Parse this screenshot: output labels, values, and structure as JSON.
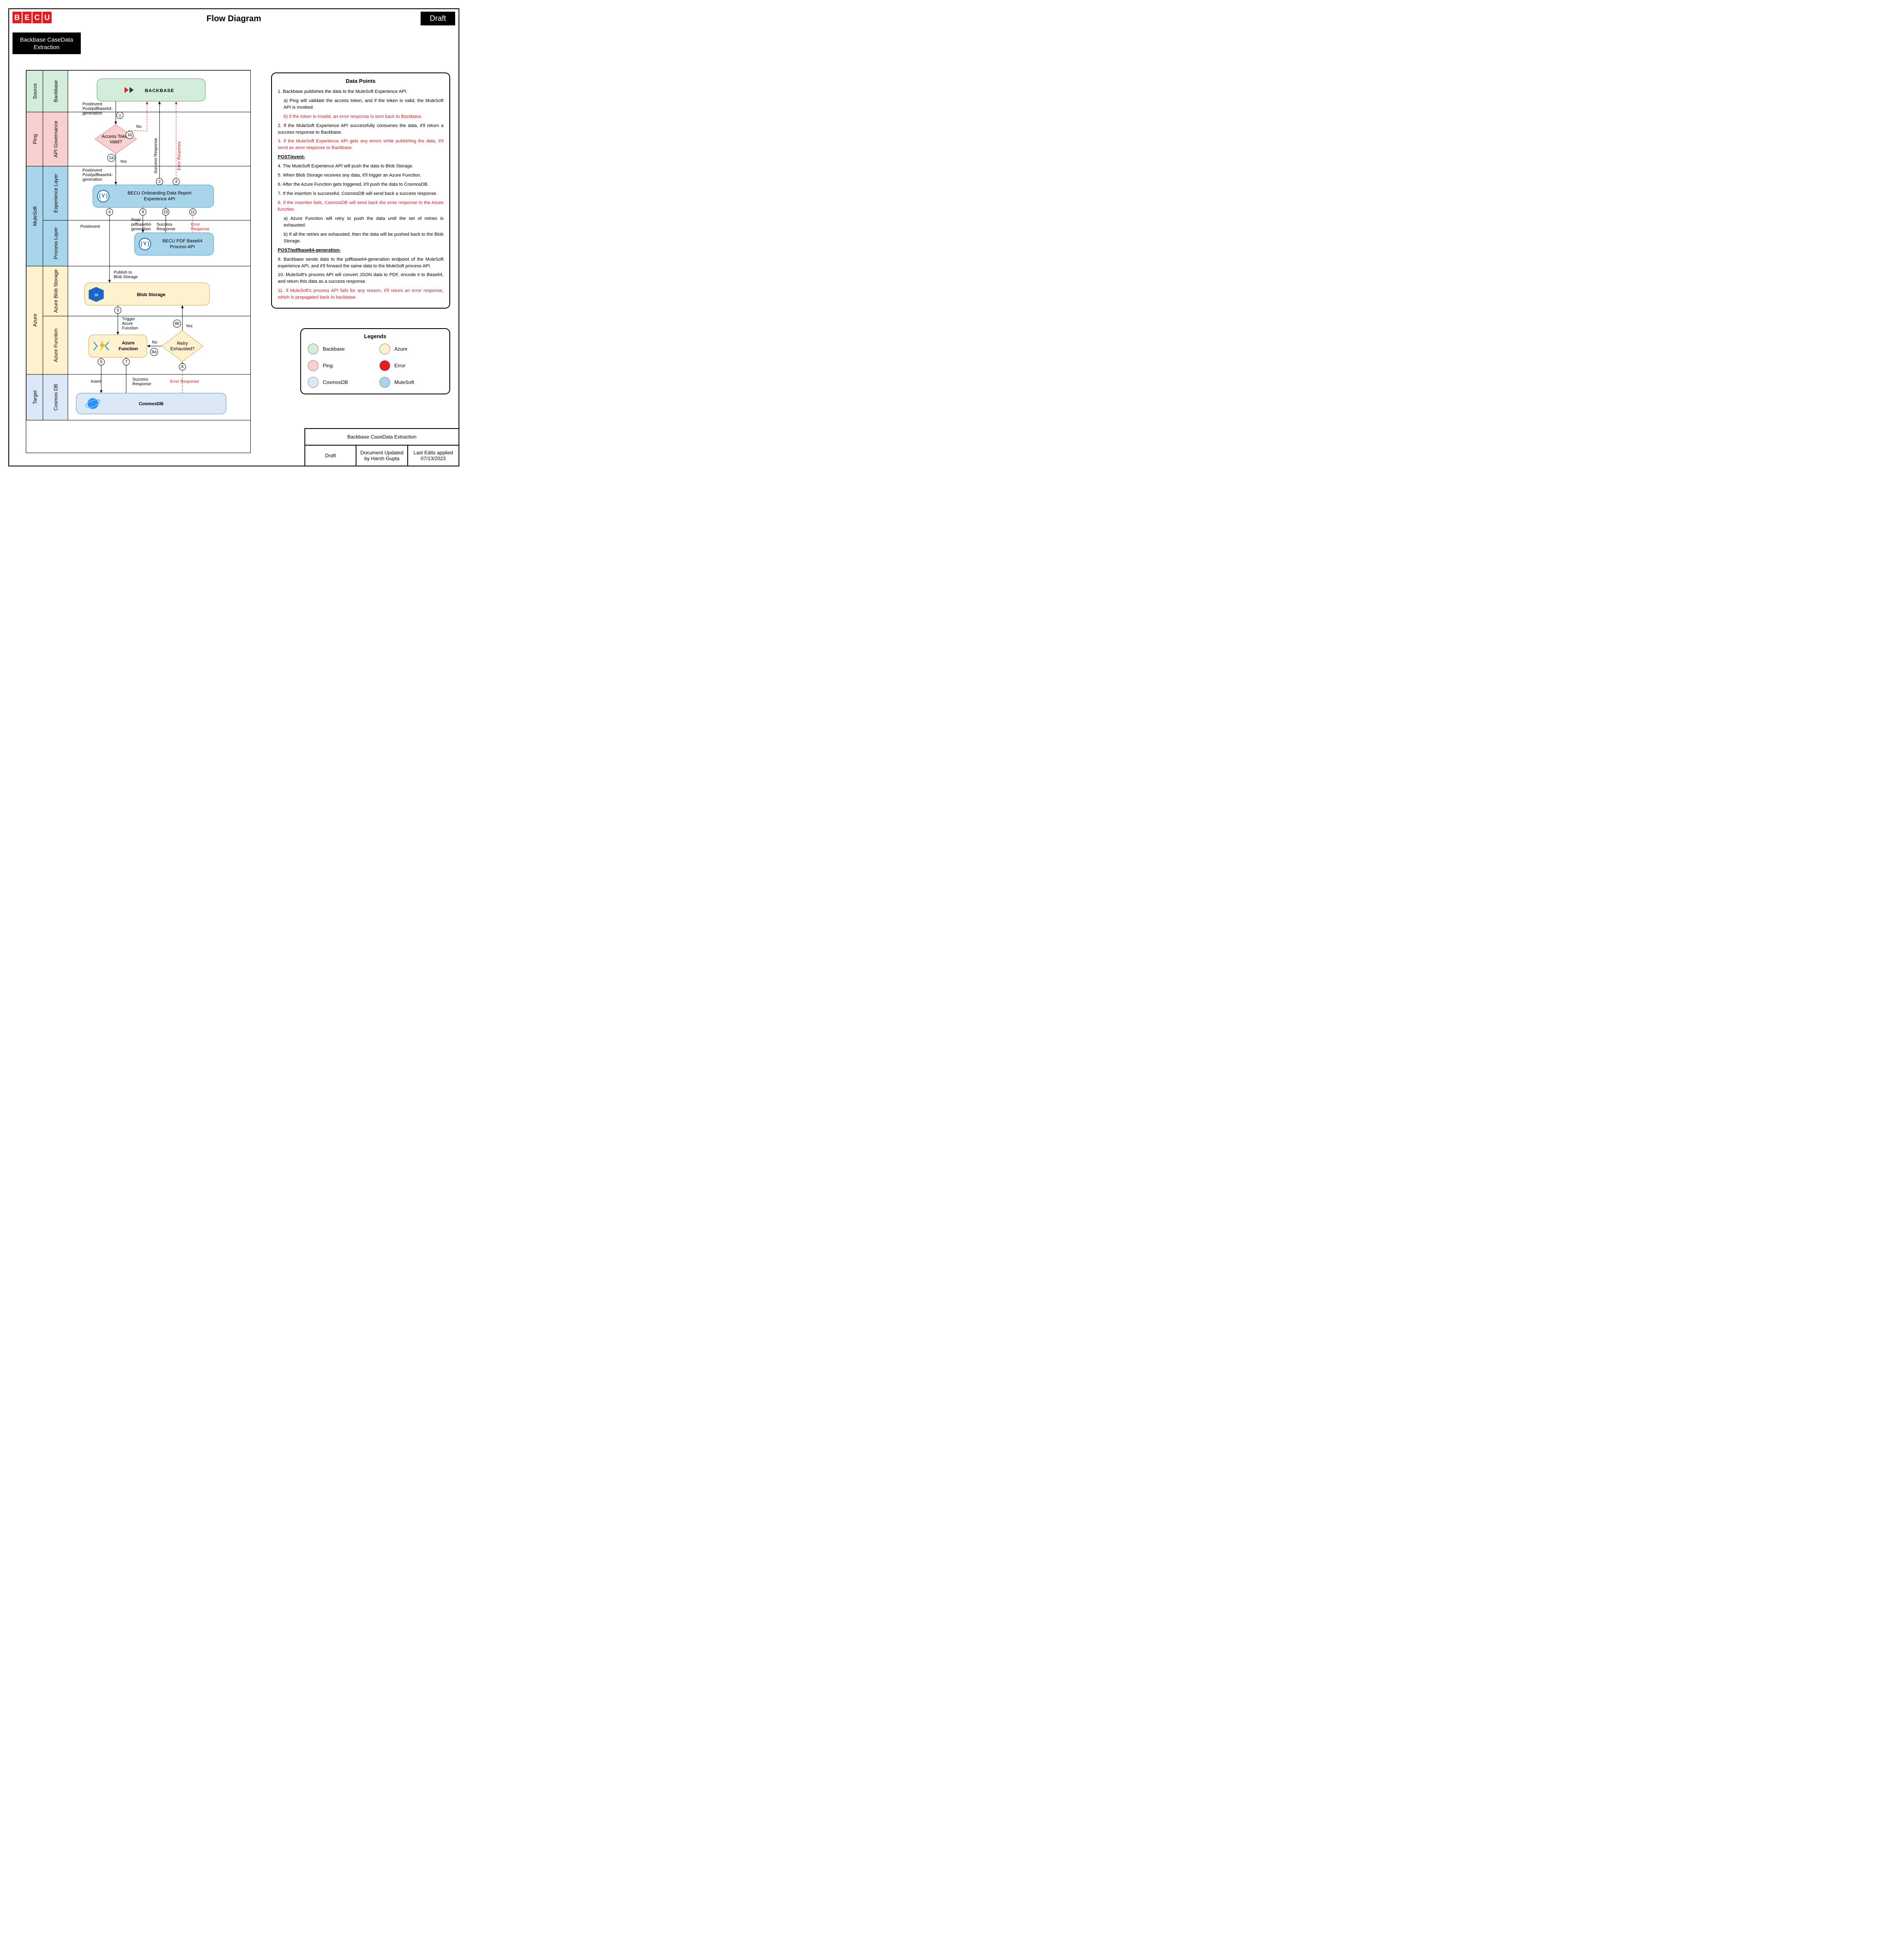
{
  "header": {
    "logo_letters": [
      "B",
      "E",
      "C",
      "U"
    ],
    "title": "Flow Diagram",
    "draft": "Draft",
    "subtitle_line1": "Backbase CaseData",
    "subtitle_line2": "Extraction"
  },
  "lanes": {
    "source": "Source",
    "backbase": "Backbase",
    "ping": "Ping",
    "api_gov": "API Governance",
    "mulesoft": "MuleSoft",
    "exp_layer": "Experience Layer",
    "process_layer": "Process Layer",
    "azure": "Azure",
    "blob": "Azure Blob Storage",
    "func": "Azure Function",
    "target": "Target",
    "cosmos": "Cosmos DB"
  },
  "nodes": {
    "backbase": "BACKBASE",
    "access_l1": "Access Token",
    "access_l2": "Valid?",
    "exp_l1": "BECU Onboarding Data Report",
    "exp_l2": "Experience API",
    "process_l1": "BECU PDF Base64",
    "process_l2": "Process API",
    "blob": "Blob Storage",
    "func_l1": "Azure",
    "func_l2": "Function",
    "retry_l1": "Retry",
    "retry_l2": "Exhausted?",
    "cosmos": "CosmosDB"
  },
  "edges": {
    "e1_l1": "Post/event",
    "e1_l2": "Post/pdfbase64-",
    "e1_l3": "generation",
    "no": "No",
    "yes": "Yes",
    "e1a_l1": "Post/event",
    "e1a_l2": "Post/pdfbase64-",
    "e1a_l3": "generation",
    "success": "Success Response",
    "error": "Error Response",
    "postevent": "Post/event",
    "e9_l1": "Post/",
    "e9_l2": "pdfbase64-",
    "e9_l3": "generation",
    "success_resp": "Success",
    "response": "Response",
    "error_l1": "Error",
    "error_l2": "Response",
    "publish_l1": "Publish to",
    "publish_l2": "Blob Storage",
    "trigger_l1": "Trigger",
    "trigger_l2": "Azure",
    "trigger_l3": "Function",
    "insert": "Insert",
    "err_resp": "Error Response"
  },
  "steps": {
    "s1": "1",
    "s1a": "1a",
    "s1b": "1b",
    "s2": "2",
    "s3": "3",
    "s4": "4",
    "s5": "5",
    "s6": "6",
    "s7": "7",
    "s8": "8",
    "s8a": "8a",
    "s8b": "8b",
    "s9": "9",
    "s10": "10",
    "s11": "11"
  },
  "data_points": {
    "title": "Data Points",
    "p1": "1. Backbase publishes the data to the MuleSoft Experience API.",
    "p1a": "a) Ping will validate the access token, and if the token is valid, the MuleSoft API is invoked.",
    "p1b": "b) If the token is invalid, an error response is sent back to Backbase.",
    "p2": "2. If the MuleSoft Experience API successfully consumes the data, it'll return a success response to Backbase.",
    "p3": "3. If the MuleSoft Experience API gets any errors while publishing the data, it'll send an error response to Backbase.",
    "h4": "POST/event-",
    "p4": "4. The MuleSoft Experience API will push the data to Blob Storage.",
    "p5": "5. When Blob Storage receives any data, it'll trigger an Azure Function.",
    "p6": "6. After the Azure Function gets triggered, it'll push the data to CosmosDB.",
    "p7": "7. If the insertion is successful, CosmosDB will send back a success response.",
    "p8": "8. If the insertion fails, CosmosDB will send back the error response to the Azure function.",
    "p8a": "a) Azure Function will retry to push the data until the set of retries is exhausted.",
    "p8b": "b) If all the retries are exhausted, then the data will be pushed back to the Blob Storage.",
    "h9": "POST/pdfbase64-generation-",
    "p9": "9. Backbase sends data to the pdfbase64-generation endpoint of the MuleSoft experience API, and it'll forward the same data to the MuleSoft process API.",
    "p10": "10. MuleSoft's process API will convert JSON data to PDF, encode it to Base64, and return this data as a success response.",
    "p11": "11. If MuleSoft's process API fails for any reason, it'll return an error response, which is propagated back to backbase."
  },
  "legend": {
    "title": "Legends",
    "backbase": "Backbase",
    "azure": "Azure",
    "ping": "Ping",
    "error": "Error",
    "cosmos": "CosmosDB",
    "mulesoft": "MuleSoft",
    "colors": {
      "backbase": "#d4edda",
      "azure": "#fdf2cd",
      "ping": "#f8d0d0",
      "error": "#e31c23",
      "cosmos": "#dae8f7",
      "mulesoft": "#a8d5eb"
    }
  },
  "footer": {
    "title": "Backbase CaseData Extraction",
    "c1": "Draft",
    "c2": "Document Updated by Harsh Gupta",
    "c3_l1": "Last Edits applied",
    "c3_l2": "07/13/2023"
  }
}
